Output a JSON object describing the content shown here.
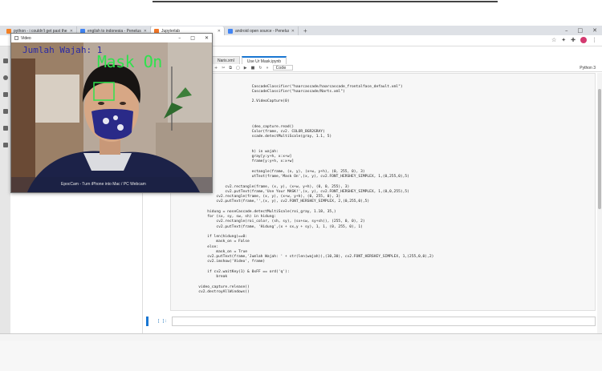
{
  "browser": {
    "tabs": [
      {
        "label": "python - i couldn't get past the",
        "color": "#f48024"
      },
      {
        "label": "english to indonesia - Penelusu",
        "color": "#4285f4"
      },
      {
        "label": "Jupyterlab",
        "color": "#f37626",
        "active": true
      },
      {
        "label": "android open source - Penelusu",
        "color": "#4285f4"
      }
    ],
    "new_tab": "+",
    "window_controls": {
      "minimize": "–",
      "maximize": "□",
      "close": "✕"
    },
    "toolbar_icons": [
      "star-icon",
      "extension-icon",
      "puzzle-icon",
      "profile-avatar",
      "menu-icon"
    ]
  },
  "jupyter": {
    "tabs": [
      {
        "label": "Naris.xml"
      },
      {
        "label": "Use Ur Mask.ipynb",
        "active": true
      }
    ],
    "toolbar": [
      "+",
      "✂",
      "⧉",
      "▢",
      "▶",
      "■",
      "↻",
      "»"
    ],
    "cell_type": "Code",
    "kernel": "Python 3",
    "code_lines": [
      "",
      "",
      "                                    CascadeClassifier(\"haarcascade/haarcascade_frontalface_default.xml\")",
      "                                    CascadeClassifier(\"haarcascade/Narts.xml\")",
      "",
      "                                    2.VideoCapture(0)",
      "",
      "",
      "",
      "",
      "                                    (deo_capture.read()",
      "                                    Color(frame, cv2. COLOR_BGR2GRAY)",
      "                                    scade.detectMultiScale(gray, 1.1, 5)",
      "",
      "",
      "                                    h) in wajah:",
      "                                    gray[y:y+h, x:x+w]",
      "                                    frame[y:y+h, x:x+w]",
      "                                    ",
      "                                    ectangle(frame, (x, y), (x+w, y+h), (0, 255, 0), 3)",
      "                                    utText(frame,'Mask On',(x, y), cv2.FONT_HERSHEY_SIMPLEX, 1,(0,255,0),5)",
      "                               ",
      "                        cv2.rectangle(frame, (x, y), (x+w, y+h), (0, 0, 255), 3)",
      "                        cv2.putText(frame,'Use Your MASK!',(x, y), cv2.FONT_HERSHEY_SIMPLEX, 1,(0,0,255),5)",
      "                    cv2.rectangle(frame, (x, y), (x+w, y+h), (0, 255, 0), 3)",
      "                    cv2.putText(frame,'',(x, y), cv2.FONT_HERSHEY_SIMPLEX, 2,(0,255,0),5)",
      "",
      "                hidung = noseCascade.detectMultiScale(roi_gray, 1.18, 35,)",
      "                for (sx, sy, sw, sh) in hidung:",
      "                    cv2.rectangle(roi_color, (sh, sy), (sx+sw, sy+sh)), (255, 0, 0), 2)",
      "                    cv2.putText(frame, 'Hidung',(x + sx,y + sy), 1, 1, (0, 255, 0), 1)",
      "",
      "                if len(hidung)==0:",
      "                    mask_on = False",
      "                else:",
      "                    mask_on = True",
      "                cv2.putText(frame,'Jumlah Wajah: ' + str(len(wajah)),(10,30), cv2.FONT_HERSHEY_SIMPLEX, 1,(255,0,0),2)",
      "                cv2.imshow('Video', frame)",
      "",
      "                if cv2.waitKey(1) & 0xFF == ord('q'):",
      "                    break",
      "",
      "            video_capture.release()",
      "            cv2.destroyAllWindows()"
    ],
    "empty_prompt": "[ ]:"
  },
  "video_window": {
    "title": "Video",
    "controls": {
      "minimize": "–",
      "maximize": "□",
      "close": "✕"
    },
    "face_count_text": "Jumlah Wajah: 1",
    "mask_status_text": "Mask On",
    "watermark": "EpocCam - Turn iPhone into Mac / PC Webcam",
    "colors": {
      "face_count": "#2a2aa6",
      "mask_status": "#2fe24d",
      "face_box": "#2fe24d"
    }
  }
}
